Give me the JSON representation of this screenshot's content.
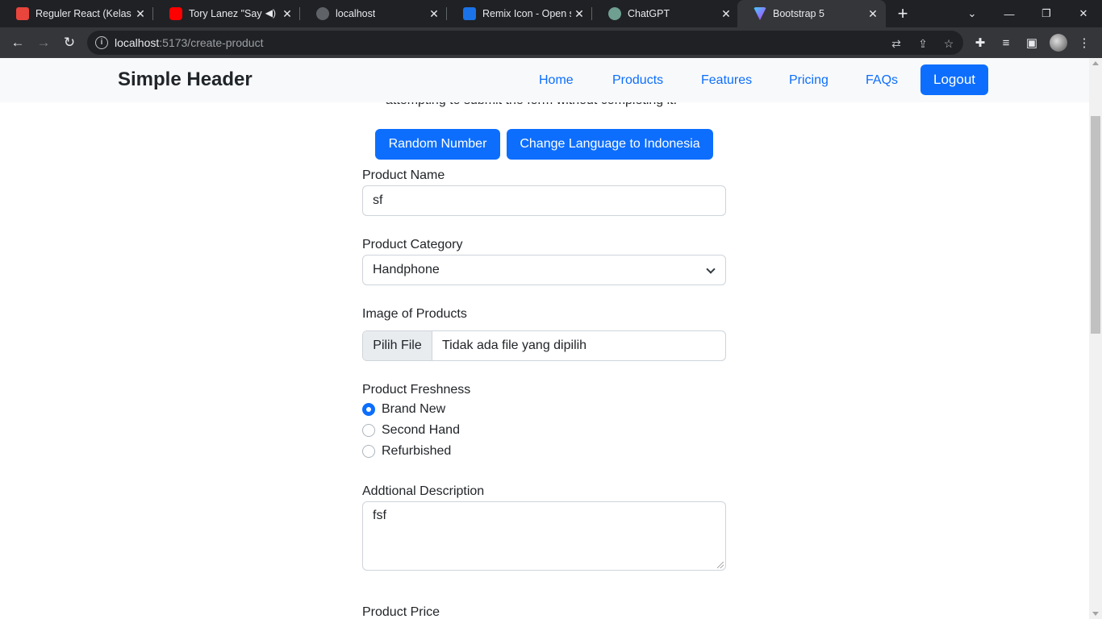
{
  "browser": {
    "tabs": [
      {
        "title": "Reguler React (Kelas A",
        "favicon": "dibimbing-icon",
        "color": "#e8453c"
      },
      {
        "title": "Tory Lanez \"Say It\"",
        "favicon": "youtube-icon",
        "color": "#ff0000",
        "audio": true
      },
      {
        "title": "localhost",
        "favicon": "react-icon",
        "color": "#5f6368"
      },
      {
        "title": "Remix Icon - Open so",
        "favicon": "remix-icon",
        "color": "#1a73e8"
      },
      {
        "title": "ChatGPT",
        "favicon": "chatgpt-icon",
        "color": "#6f9f90"
      },
      {
        "title": "Bootstrap 5",
        "favicon": "vite-icon",
        "color": "#9f6bff",
        "active": true
      }
    ],
    "url_host": "localhost",
    "url_path": ":5173/create-product"
  },
  "header": {
    "brand": "Simple Header",
    "nav": [
      "Home",
      "Products",
      "Features",
      "Pricing",
      "FAQs"
    ],
    "logout": "Logout"
  },
  "page": {
    "partial_text": "attempting to submit the form without completing it.",
    "random_button": "Random Number",
    "language_button": "Change Language to Indonesia"
  },
  "form": {
    "product_name_label": "Product Name",
    "product_name_value": "sf",
    "category_label": "Product Category",
    "category_value": "Handphone",
    "image_label": "Image of Products",
    "file_button": "Pilih File",
    "file_status": "Tidak ada file yang dipilih",
    "freshness_label": "Product Freshness",
    "freshness_options": [
      "Brand New",
      "Second Hand",
      "Refurbished"
    ],
    "freshness_selected": "Brand New",
    "description_label": "Addtional Description",
    "description_value": "fsf",
    "price_label": "Product Price"
  },
  "colors": {
    "primary": "#0d6efd",
    "header_bg": "#f8f9fa",
    "browser_dark": "#202124"
  }
}
